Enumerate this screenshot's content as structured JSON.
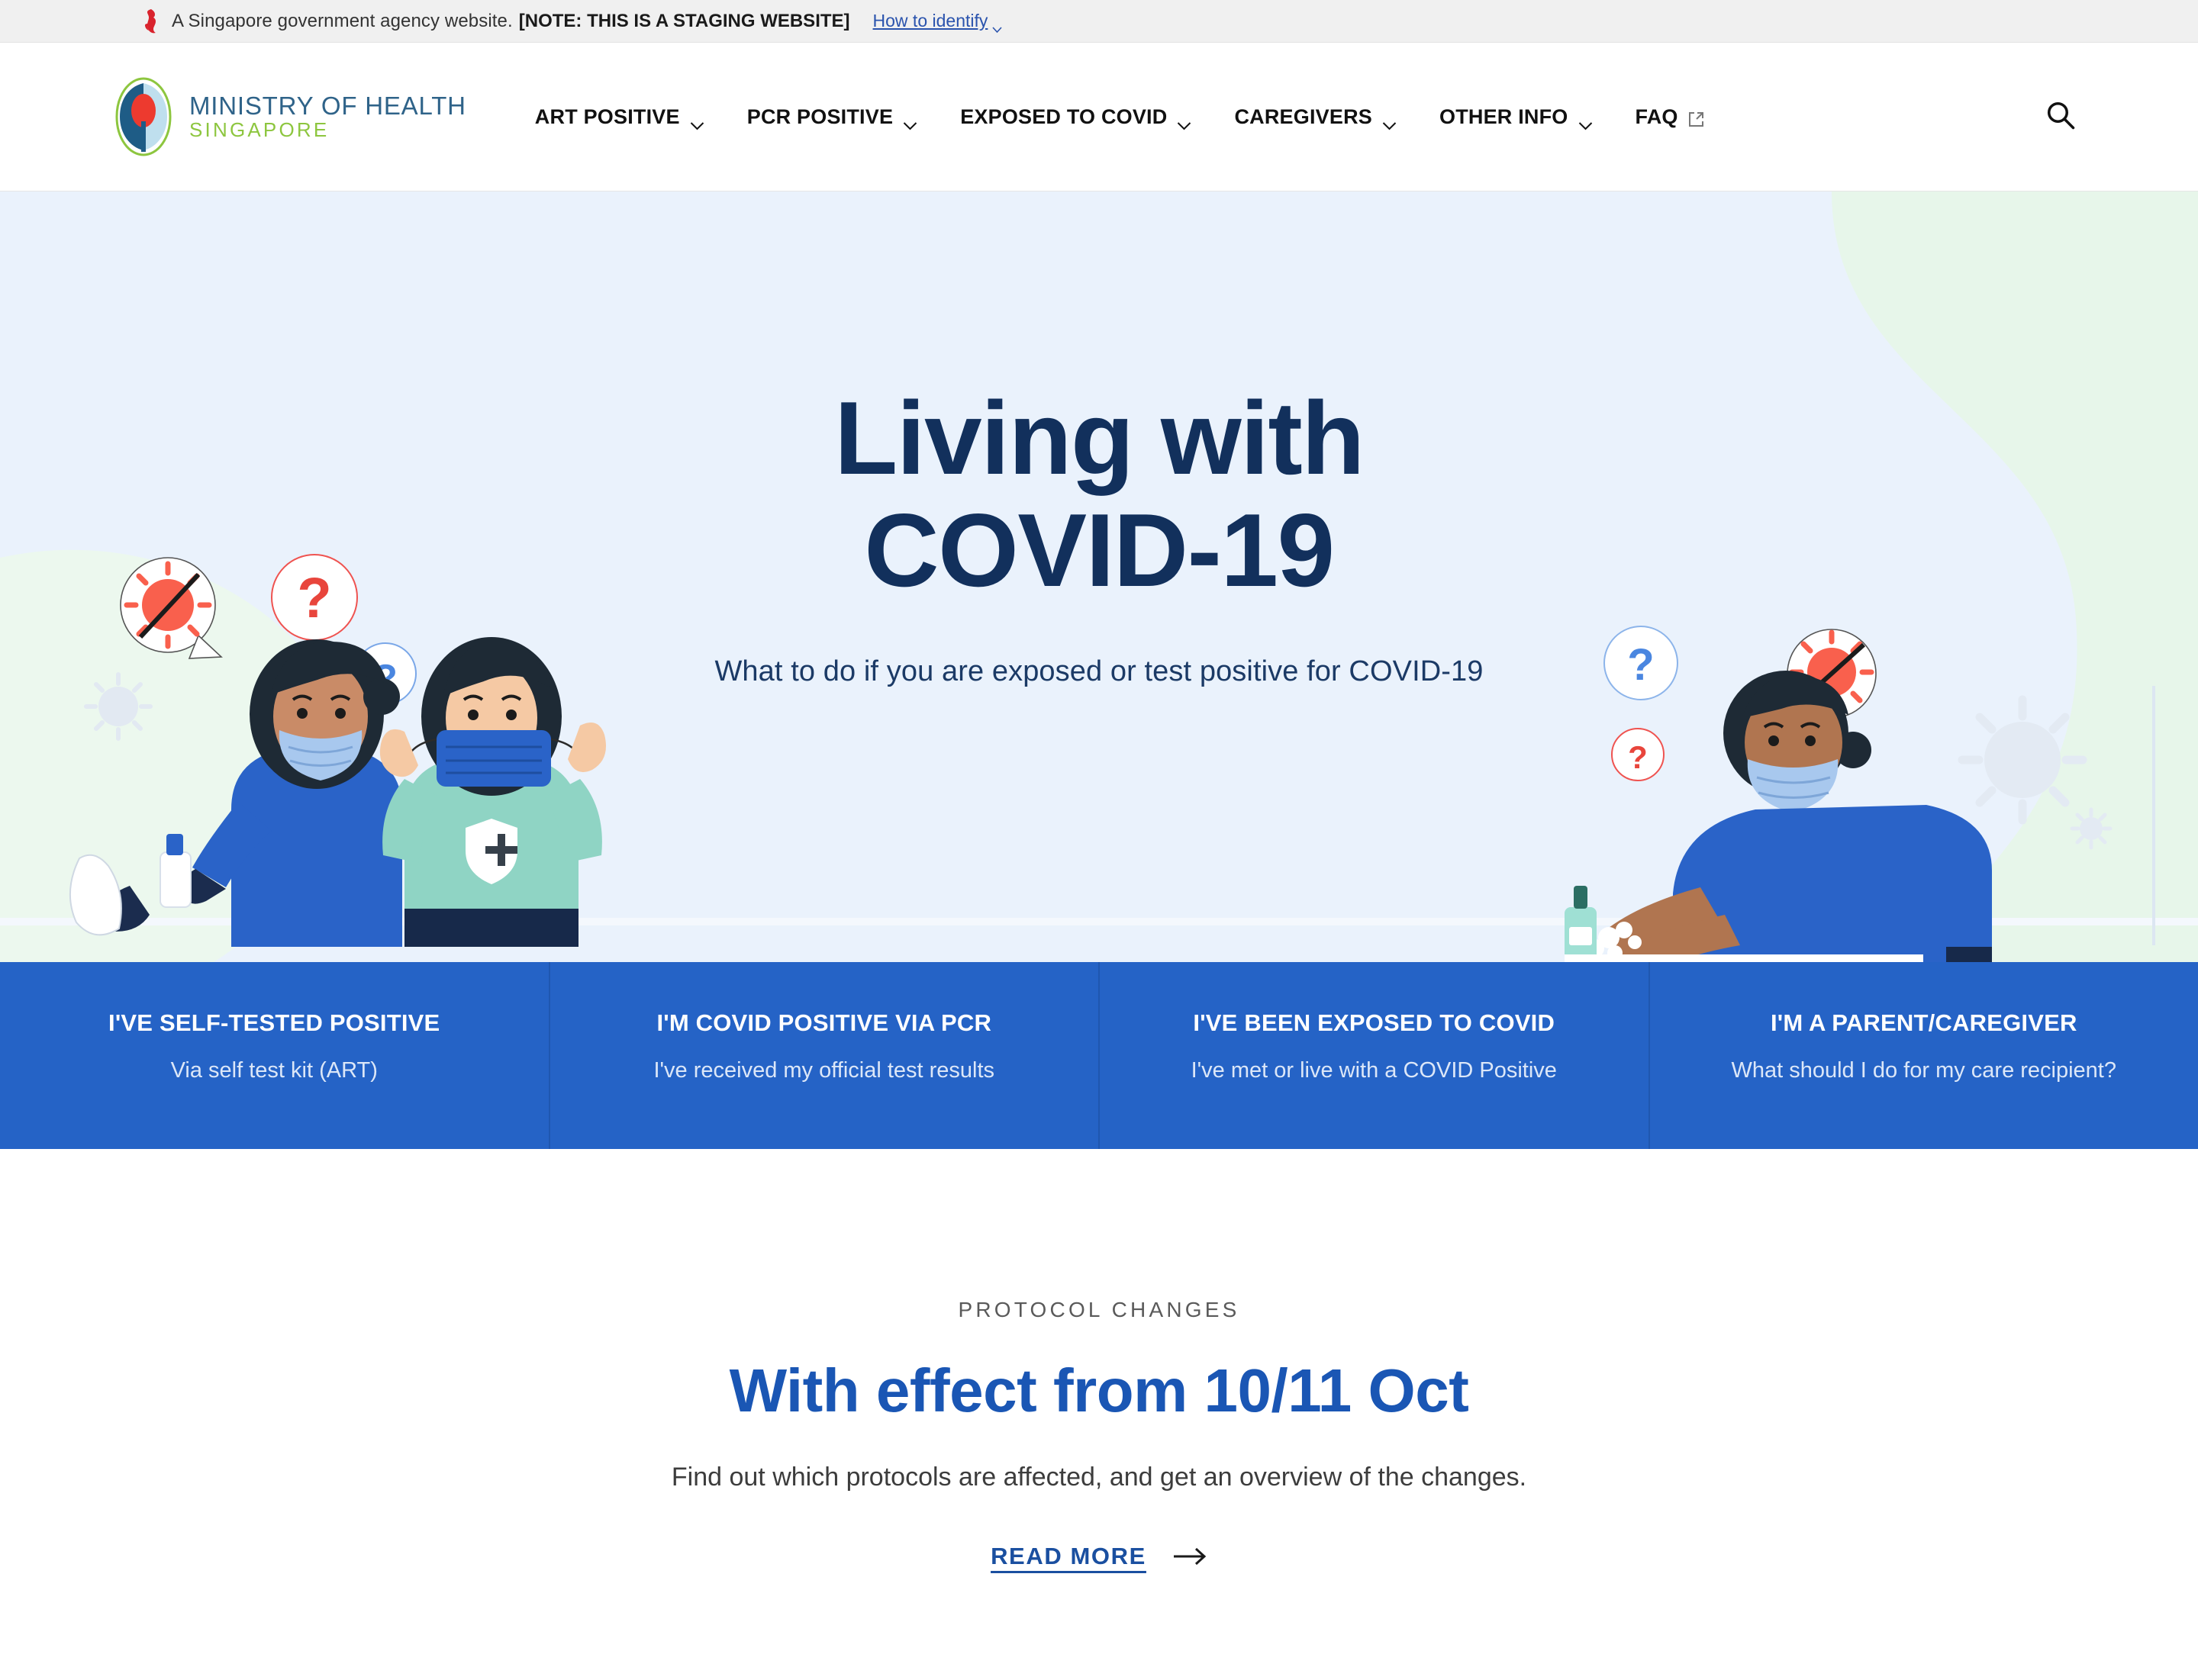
{
  "masthead": {
    "icon": "singapore-lion-icon",
    "text": "A Singapore government agency website.",
    "note": "[NOTE: THIS IS A STAGING WEBSITE]",
    "link": "How to identify",
    "chevron_icon": "chevron-down-icon"
  },
  "header": {
    "logo_icon": "moh-logo-icon",
    "brand_line1": "MINISTRY OF HEALTH",
    "brand_line2": "SINGAPORE",
    "search_icon": "search-icon",
    "nav": [
      {
        "label": "ART POSITIVE",
        "icon": "chevron-down-icon",
        "external": false
      },
      {
        "label": "PCR POSITIVE",
        "icon": "chevron-down-icon",
        "external": false
      },
      {
        "label": "EXPOSED TO COVID",
        "icon": "chevron-down-icon",
        "external": false
      },
      {
        "label": "CAREGIVERS",
        "icon": "chevron-down-icon",
        "external": false
      },
      {
        "label": "OTHER INFO",
        "icon": "chevron-down-icon",
        "external": false
      },
      {
        "label": "FAQ",
        "icon": "external-link-icon",
        "external": true
      }
    ]
  },
  "hero": {
    "title_line1": "Living with",
    "title_line2": "COVID-19",
    "subtitle": "What to do if you are exposed or test positive for COVID-19",
    "background_color": "#eaf2fc",
    "accent_green": "#e7f6ea",
    "title_color": "#12305c",
    "illustration_left": "two-women-mask-sanitiser-illustration",
    "illustration_right": "man-washing-hands-illustration"
  },
  "cards": {
    "background_color": "#2563c6",
    "items": [
      {
        "title": "I'VE SELF-TESTED POSITIVE",
        "desc": "Via self test kit (ART)"
      },
      {
        "title": "I'M COVID POSITIVE VIA PCR",
        "desc": "I've received my official test results"
      },
      {
        "title": "I'VE BEEN EXPOSED TO COVID",
        "desc": "I've met or live with a COVID Positive"
      },
      {
        "title": "I'M A PARENT/CAREGIVER",
        "desc": "What should I do for my care recipient?"
      }
    ]
  },
  "protocol": {
    "eyebrow": "PROTOCOL CHANGES",
    "title": "With effect from 10/11 Oct",
    "desc": "Find out which protocols are affected, and get an overview of the changes.",
    "read_more": "READ MORE",
    "arrow_icon": "arrow-right-icon",
    "title_color": "#1a56b4"
  }
}
